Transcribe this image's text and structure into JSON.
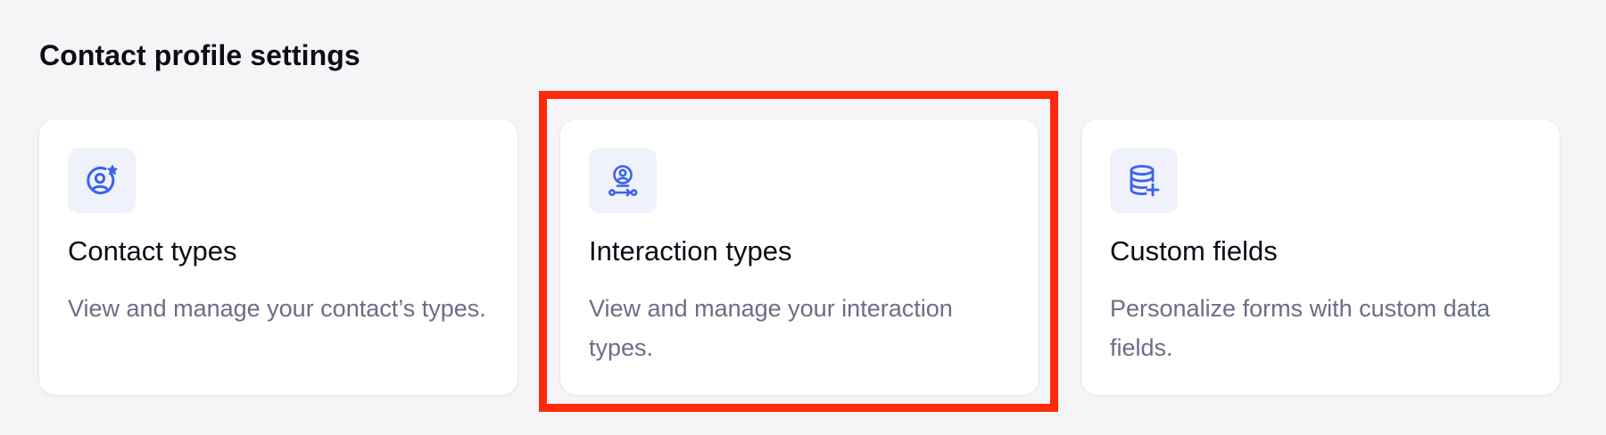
{
  "section": {
    "title": "Contact profile settings"
  },
  "cards": [
    {
      "title": "Contact types",
      "description": "View and manage your contact’s types.",
      "icon": "user-star-icon"
    },
    {
      "title": "Interaction types",
      "description": "View and manage your interaction types.",
      "icon": "user-interaction-icon"
    },
    {
      "title": "Custom fields",
      "description": "Personalize forms with custom data fields.",
      "icon": "database-plus-icon"
    }
  ],
  "colors": {
    "accent": "#3b63e8",
    "icon_bg": "#eff1fb",
    "highlight": "#ff2a0a",
    "title_text": "#0b0d17",
    "desc_text": "#6b6e86"
  }
}
